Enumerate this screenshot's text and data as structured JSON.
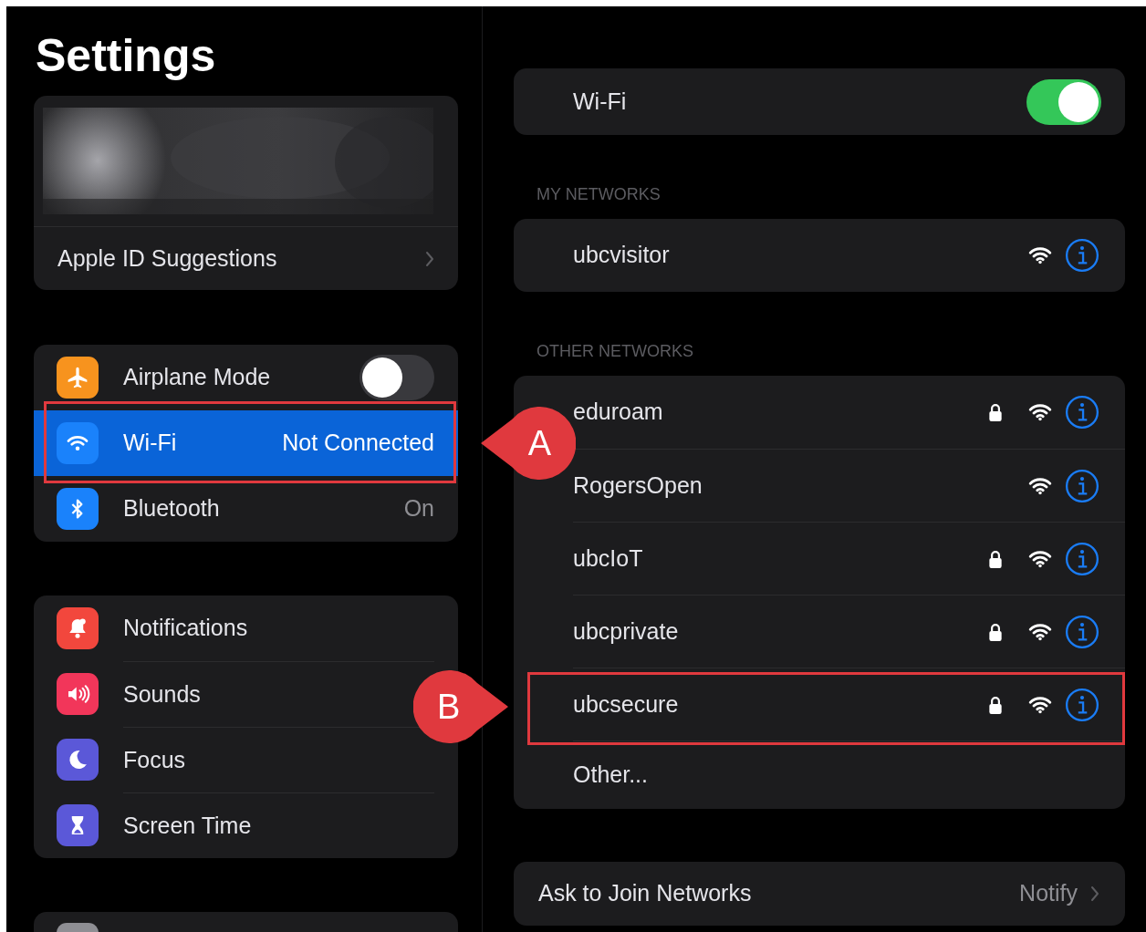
{
  "sidebar": {
    "title": "Settings",
    "profile": {
      "kind": "picture",
      "suggestion": "Apple ID Suggestions"
    },
    "groups": [
      [
        {
          "kind": "toggle",
          "label": "Airplane Mode",
          "on": false,
          "selected": false,
          "color": "#f7931e"
        },
        {
          "kind": "link",
          "label": "Wi-Fi",
          "value": "Not Connected",
          "selected": true,
          "color": "#1a82fb"
        },
        {
          "kind": "link",
          "label": "Bluetooth",
          "value": "On",
          "selected": false,
          "color": "#1a82fb"
        }
      ],
      [
        {
          "kind": "link",
          "label": "Notifications",
          "selected": false,
          "color": "#f2473d"
        },
        {
          "kind": "link",
          "label": "Sounds",
          "selected": false,
          "color": "#f2365a"
        },
        {
          "kind": "link",
          "label": "Focus",
          "selected": false,
          "color": "#5b58d8"
        },
        {
          "kind": "link",
          "label": "Screen Time",
          "selected": false,
          "color": "#5b58d8"
        }
      ],
      [
        {
          "kind": "link",
          "selected": false,
          "color": "#8e8e93"
        }
      ]
    ]
  },
  "detail": {
    "wifi": {
      "label": "Wi-Fi",
      "on": true
    },
    "sections": [
      {
        "header": "MY NETWORKS",
        "networks": [
          {
            "kind": "network",
            "name": "ubcvisitor",
            "locked": false
          }
        ]
      },
      {
        "header": "OTHER NETWORKS",
        "networks": [
          {
            "kind": "network",
            "name": "eduroam",
            "locked": true
          },
          {
            "kind": "network",
            "name": "RogersOpen",
            "locked": false
          },
          {
            "kind": "network",
            "name": "ubcIoT",
            "locked": true
          },
          {
            "kind": "network",
            "name": "ubcprivate",
            "locked": true
          },
          {
            "kind": "network",
            "name": "ubcsecure",
            "locked": true
          },
          {
            "kind": "other",
            "name": "Other..."
          }
        ]
      }
    ],
    "ask_to_join": {
      "label": "Ask to Join Networks",
      "value": "Notify"
    }
  },
  "annotations": [
    {
      "label": "A"
    },
    {
      "label": "B"
    }
  ]
}
